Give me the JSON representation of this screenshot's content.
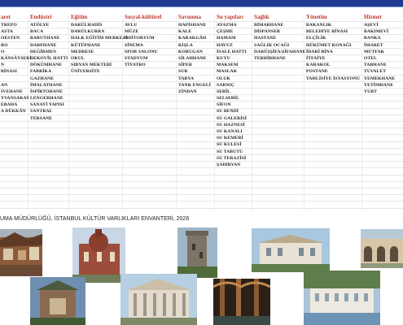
{
  "columns": [
    {
      "header": "aret",
      "items": [
        "TREPO",
        "ASTA",
        "OESTEN",
        "RO",
        "O",
        "KÂNSÂYSERİ",
        "N",
        "BİNASI",
        "",
        "AN",
        "IVEHANE",
        "YVANSARAY",
        "EBAHA",
        "A DÜKKÂN"
      ]
    },
    {
      "header": "Endüstri",
      "items": [
        "ATÖLYE",
        "BACA",
        "BARUTHANE",
        "DARPHANE",
        "DEĞİRMEN",
        "DEKOVİL HATTI",
        "DÖKÜMHANE",
        "FABRİKA",
        "GAZHANE",
        "İMALATHANE",
        "İSPİRTOHANE",
        "LENGERHANE",
        "SANAYİ YAPISI",
        "SANTRAL",
        "TERSANE"
      ]
    },
    {
      "header": "Eğitim",
      "items": [
        "DARÜLHADİS",
        "DARÜLKURRA",
        "HALK EĞİTİM MERKEZİ",
        "KÜTÜPHANE",
        "MEDRESE",
        "OKUL",
        "SIBYAN MEKTEBİ",
        "ÜNİVERSİTE"
      ]
    },
    {
      "header": "Sosyal-kültürel",
      "items": [
        "AVLU",
        "MÜZE",
        "ODİTORYUM",
        "SİNEMA",
        "SPOR SALONU",
        "STADYUM",
        "TİYATRO"
      ]
    },
    {
      "header": "Savunma",
      "items": [
        "HAPİSHANE",
        "KALE",
        "KARAKGÂH",
        "KIŞLA",
        "KORUGAN",
        "SİLAHHANE",
        "SİPER",
        "SUR",
        "TABYA",
        "TANK ENGELİ",
        "ZİNDAN"
      ]
    },
    {
      "header": "Su yapıları",
      "items": [
        "AYAZMA",
        "ÇEŞME",
        "HAMAM",
        "HAVUZ",
        "İSALE HATTI",
        "KUYU",
        "MAKSEM",
        "MASLAK",
        "OLUK",
        "SARNIÇ",
        "SEBİL",
        "SELSEBİL",
        "SİFON",
        "SU BENDİ",
        "SU GALERİSİ",
        "SU HAZNESİ",
        "SU KANALI",
        "SU KEMERİ",
        "SU KULESİ",
        "SU TABUTU",
        "SU TERAZİSİ",
        "ŞADIRVAN"
      ]
    },
    {
      "header": "Sağlık",
      "items": [
        "BİMARHANE",
        "DİSPANSER",
        "HASTANE",
        "SAĞLIK OCAĞI",
        "DARÜŞŞİFA/ŞİFAHANE",
        "TEBHİRHANE"
      ]
    },
    {
      "header": "Yönetim",
      "items": [
        "BAKANLIK",
        "BELEDİYE BİNASI",
        "ELÇİLİK",
        "HÜKÜMET KONAĞI",
        "İDARİ BİNA",
        "İTFAİYE",
        "KARAKOL",
        "POSTANE",
        "TAHLİSİYE İSTASYONU"
      ]
    },
    {
      "header": "Hizmet",
      "items": [
        "AŞEVİ",
        "BAKIMEVİ",
        "BANKA",
        "İMARET",
        "MUTFAK",
        "OTEL",
        "TABHANE",
        "TUVALET",
        "YEMEKHANE",
        "YETİMHANE",
        "YURT"
      ]
    }
  ],
  "caption": "UMA MÜDÜRLÜĞÜ, İSTANBUL KÜLTÜR VARLIKLARI ENVANTERİ, 2026",
  "photos": [
    {
      "name": "wooden-houses-photo"
    },
    {
      "name": "brick-church-photo"
    },
    {
      "name": "fortress-tower-photo"
    },
    {
      "name": "waterfront-mansion-photo"
    },
    {
      "name": "arcade-courtyard-photo"
    },
    {
      "name": "ornate-fountain-photo"
    },
    {
      "name": "museum-facade-photo"
    },
    {
      "name": "cistern-interior-photo"
    },
    {
      "name": "palace-pavilion-photo"
    }
  ]
}
